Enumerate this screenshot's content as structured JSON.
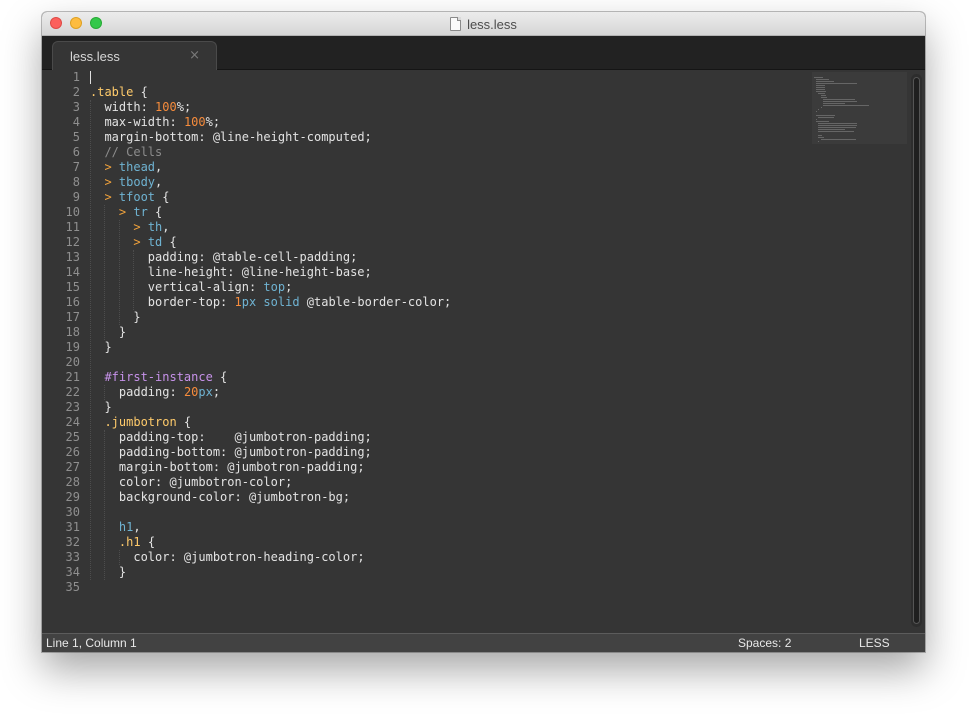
{
  "window": {
    "title": "less.less"
  },
  "tabs": [
    {
      "label": "less.less",
      "close_glyph": "×"
    }
  ],
  "editor": {
    "current_line": 1,
    "lines": [
      {
        "n": "1",
        "indent": 0,
        "tokens": []
      },
      {
        "n": "2",
        "indent": 0,
        "tokens": [
          {
            "t": ".table",
            "c": "c-class"
          },
          {
            "t": " {",
            "c": ""
          }
        ]
      },
      {
        "n": "3",
        "indent": 1,
        "tokens": [
          {
            "t": "width: ",
            "c": ""
          },
          {
            "t": "100",
            "c": "c-num"
          },
          {
            "t": "%;",
            "c": ""
          }
        ]
      },
      {
        "n": "4",
        "indent": 1,
        "tokens": [
          {
            "t": "max-width: ",
            "c": ""
          },
          {
            "t": "100",
            "c": "c-num"
          },
          {
            "t": "%;",
            "c": ""
          }
        ]
      },
      {
        "n": "5",
        "indent": 1,
        "tokens": [
          {
            "t": "margin-bottom: @line-height-computed;",
            "c": ""
          }
        ]
      },
      {
        "n": "6",
        "indent": 1,
        "tokens": [
          {
            "t": "// Cells",
            "c": "c-comment"
          }
        ]
      },
      {
        "n": "7",
        "indent": 1,
        "tokens": [
          {
            "t": "> ",
            "c": "c-op"
          },
          {
            "t": "thead",
            "c": "c-tag"
          },
          {
            "t": ",",
            "c": ""
          }
        ]
      },
      {
        "n": "8",
        "indent": 1,
        "tokens": [
          {
            "t": "> ",
            "c": "c-op"
          },
          {
            "t": "tbody",
            "c": "c-tag"
          },
          {
            "t": ",",
            "c": ""
          }
        ]
      },
      {
        "n": "9",
        "indent": 1,
        "tokens": [
          {
            "t": "> ",
            "c": "c-op"
          },
          {
            "t": "tfoot",
            "c": "c-tag"
          },
          {
            "t": " {",
            "c": ""
          }
        ]
      },
      {
        "n": "10",
        "indent": 2,
        "tokens": [
          {
            "t": "> ",
            "c": "c-op"
          },
          {
            "t": "tr",
            "c": "c-tag"
          },
          {
            "t": " {",
            "c": ""
          }
        ]
      },
      {
        "n": "11",
        "indent": 3,
        "tokens": [
          {
            "t": "> ",
            "c": "c-op"
          },
          {
            "t": "th",
            "c": "c-tag"
          },
          {
            "t": ",",
            "c": ""
          }
        ]
      },
      {
        "n": "12",
        "indent": 3,
        "tokens": [
          {
            "t": "> ",
            "c": "c-op"
          },
          {
            "t": "td",
            "c": "c-tag"
          },
          {
            "t": " {",
            "c": ""
          }
        ]
      },
      {
        "n": "13",
        "indent": 4,
        "tokens": [
          {
            "t": "padding: @table-cell-padding;",
            "c": ""
          }
        ]
      },
      {
        "n": "14",
        "indent": 4,
        "tokens": [
          {
            "t": "line-height: @line-height-base;",
            "c": ""
          }
        ]
      },
      {
        "n": "15",
        "indent": 4,
        "tokens": [
          {
            "t": "vertical-align: ",
            "c": ""
          },
          {
            "t": "top",
            "c": "c-val"
          },
          {
            "t": ";",
            "c": ""
          }
        ]
      },
      {
        "n": "16",
        "indent": 4,
        "tokens": [
          {
            "t": "border-top: ",
            "c": ""
          },
          {
            "t": "1",
            "c": "c-num"
          },
          {
            "t": "px ",
            "c": "c-val"
          },
          {
            "t": "solid",
            "c": "c-val"
          },
          {
            "t": " @table-border-color;",
            "c": ""
          }
        ]
      },
      {
        "n": "17",
        "indent": 3,
        "tokens": [
          {
            "t": "}",
            "c": ""
          }
        ]
      },
      {
        "n": "18",
        "indent": 2,
        "tokens": [
          {
            "t": "}",
            "c": ""
          }
        ]
      },
      {
        "n": "19",
        "indent": 1,
        "tokens": [
          {
            "t": "}",
            "c": ""
          }
        ]
      },
      {
        "n": "20",
        "indent": 0,
        "tokens": []
      },
      {
        "n": "21",
        "indent": 1,
        "tokens": [
          {
            "t": "#first-instance",
            "c": "c-id"
          },
          {
            "t": " {",
            "c": ""
          }
        ]
      },
      {
        "n": "22",
        "indent": 2,
        "tokens": [
          {
            "t": "padding: ",
            "c": ""
          },
          {
            "t": "20",
            "c": "c-num"
          },
          {
            "t": "px",
            "c": "c-val"
          },
          {
            "t": ";",
            "c": ""
          }
        ]
      },
      {
        "n": "23",
        "indent": 1,
        "tokens": [
          {
            "t": "}",
            "c": ""
          }
        ]
      },
      {
        "n": "24",
        "indent": 1,
        "tokens": [
          {
            "t": ".jumbotron",
            "c": "c-class"
          },
          {
            "t": " {",
            "c": ""
          }
        ]
      },
      {
        "n": "25",
        "indent": 2,
        "tokens": [
          {
            "t": "padding-top:    @jumbotron-padding;",
            "c": ""
          }
        ]
      },
      {
        "n": "26",
        "indent": 2,
        "tokens": [
          {
            "t": "padding-bottom: @jumbotron-padding;",
            "c": ""
          }
        ]
      },
      {
        "n": "27",
        "indent": 2,
        "tokens": [
          {
            "t": "margin-bottom: @jumbotron-padding;",
            "c": ""
          }
        ]
      },
      {
        "n": "28",
        "indent": 2,
        "tokens": [
          {
            "t": "color: @jumbotron-color;",
            "c": ""
          }
        ]
      },
      {
        "n": "29",
        "indent": 2,
        "tokens": [
          {
            "t": "background-color: @jumbotron-bg;",
            "c": ""
          }
        ]
      },
      {
        "n": "30",
        "indent": 0,
        "tokens": []
      },
      {
        "n": "31",
        "indent": 2,
        "tokens": [
          {
            "t": "h1",
            "c": "c-tag"
          },
          {
            "t": ",",
            "c": ""
          }
        ]
      },
      {
        "n": "32",
        "indent": 2,
        "tokens": [
          {
            "t": ".h1",
            "c": "c-class"
          },
          {
            "t": " {",
            "c": ""
          }
        ]
      },
      {
        "n": "33",
        "indent": 3,
        "tokens": [
          {
            "t": "color: @jumbotron-heading-color;",
            "c": ""
          }
        ]
      },
      {
        "n": "34",
        "indent": 2,
        "tokens": [
          {
            "t": "}",
            "c": ""
          }
        ]
      },
      {
        "n": "35",
        "indent": 0,
        "tokens": []
      }
    ]
  },
  "statusbar": {
    "position": "Line 1, Column 1",
    "indentation": "Spaces: 2",
    "syntax": "LESS"
  },
  "colors": {
    "background": "#353535",
    "class_selector": "#ffcb6b",
    "tag": "#6fb3d2",
    "operator": "#f0a23c",
    "number": "#f78c3c",
    "comment": "#8c8c8c",
    "id_selector": "#c792ea"
  }
}
